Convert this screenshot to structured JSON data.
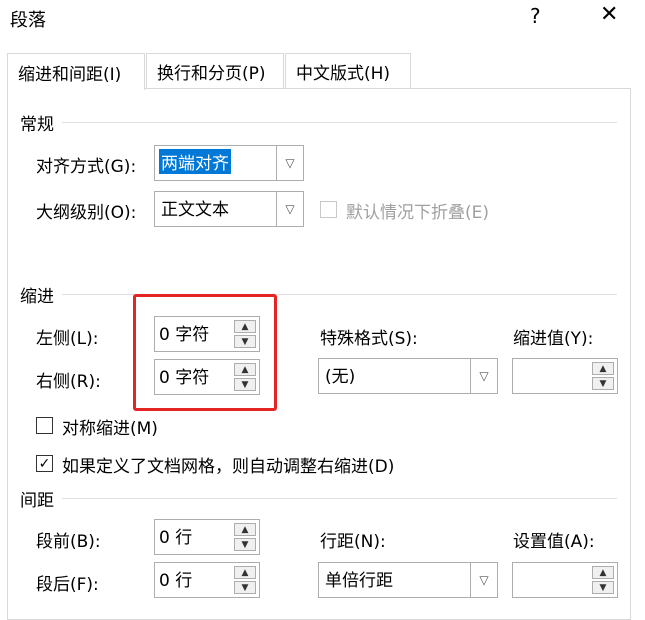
{
  "window": {
    "title": "段落",
    "help_glyph": "?",
    "close_glyph": "✕"
  },
  "tabs": [
    {
      "label": "缩进和间距(I)",
      "active": true
    },
    {
      "label": "换行和分页(P)",
      "active": false
    },
    {
      "label": "中文版式(H)",
      "active": false
    }
  ],
  "general": {
    "heading": "常规",
    "alignment": {
      "label": "对齐方式(G):",
      "value": "两端对齐"
    },
    "outline": {
      "label": "大纲级别(O):",
      "value": "正文文本"
    },
    "collapse": {
      "label": "默认情况下折叠(E)",
      "checked": false,
      "disabled": true
    }
  },
  "indent": {
    "heading": "缩进",
    "left": {
      "label": "左侧(L):",
      "value": "0 字符"
    },
    "right": {
      "label": "右侧(R):",
      "value": "0 字符"
    },
    "special": {
      "label": "特殊格式(S):",
      "value": "(无)"
    },
    "by": {
      "label": "缩进值(Y):",
      "value": ""
    },
    "mirror": {
      "label": "对称缩进(M)",
      "checked": false
    },
    "auto_adjust": {
      "label": "如果定义了文档网格，则自动调整右缩进(D)",
      "checked": true
    },
    "highlight_color": "#e52424"
  },
  "spacing": {
    "heading": "间距",
    "before": {
      "label": "段前(B):",
      "value": "0 行"
    },
    "after": {
      "label": "段后(F):",
      "value": "0 行"
    },
    "line_spacing": {
      "label": "行距(N):",
      "value": "单倍行距"
    },
    "at": {
      "label": "设置值(A):",
      "value": ""
    }
  },
  "colors": {
    "selection": "#0078d7",
    "border": "#adadad"
  }
}
